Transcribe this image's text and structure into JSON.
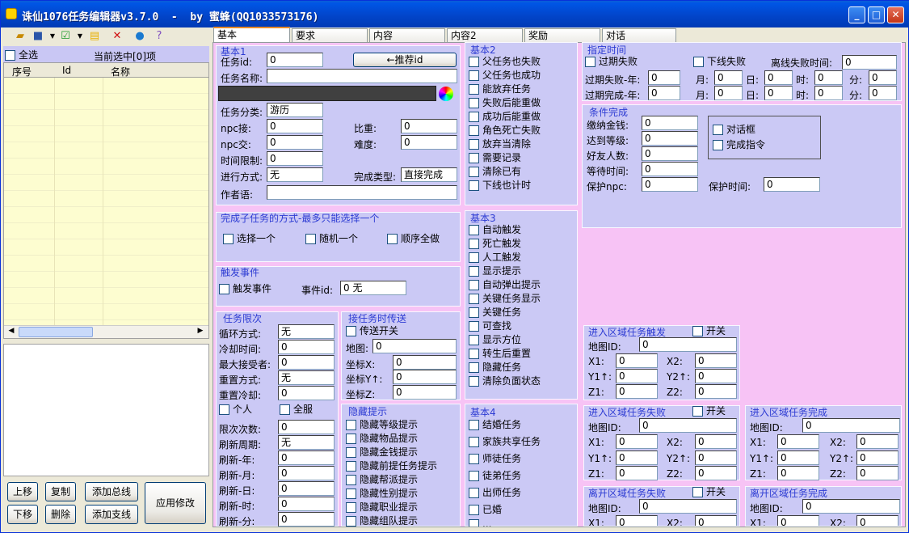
{
  "window": {
    "title": "诛仙1076任务编辑器v3.7.0  -  by 蜜蜂(QQ1033573176)",
    "min": "_",
    "max": "□",
    "close": "✕"
  },
  "toolbar": {
    "icons": [
      "open-folder-icon",
      "save-icon",
      "dropdown-arrow-icon",
      "check-green-icon",
      "dropdown-arrow-icon",
      "folder-icon",
      "delete-x-icon",
      "check-blue-icon",
      "help-icon"
    ]
  },
  "left": {
    "select_all": "全选",
    "selected": "当前选中[0]项",
    "columns": [
      "序号",
      "Id",
      "名称"
    ],
    "buttons": {
      "up": "上移",
      "copy": "复制",
      "add_main": "添加总线",
      "apply": "应用修改",
      "down": "下移",
      "delete": "删除",
      "add_branch": "添加支线"
    }
  },
  "tabs": [
    "基本",
    "要求",
    "内容",
    "内容2",
    "奖励",
    "对话"
  ],
  "basic1": {
    "title": "基本1",
    "id_label": "任务id:",
    "id": "0",
    "recommend": "←推荐id",
    "name_label": "任务名称:",
    "name": "",
    "category_label": "任务分类:",
    "category": "游历",
    "npc_recv_label": "npc接:",
    "npc_recv": "0",
    "weight_label": "比重:",
    "weight": "0",
    "npc_turn_label": "npc交:",
    "npc_turn": "0",
    "difficulty_label": "难度:",
    "difficulty": "0",
    "time_limit_label": "时间限制:",
    "time_limit": "0",
    "mode_label": "进行方式:",
    "mode": "无",
    "complete_type_label": "完成类型:",
    "complete_type": "直接完成",
    "author_label": "作者语:",
    "author": ""
  },
  "subtask": {
    "title": "完成子任务的方式-最多只能选择一个",
    "opts": [
      "选择一个",
      "随机一个",
      "顺序全做"
    ]
  },
  "trigger": {
    "title": "触发事件",
    "cb": "触发事件",
    "event_label": "事件id:",
    "event": "0  无"
  },
  "limit": {
    "title": "任务限次",
    "loop_label": "循环方式:",
    "loop": "无",
    "cooldown_label": "冷却时间:",
    "cooldown": "0",
    "max_label": "最大接受者:",
    "max": "0",
    "reset_label": "重置方式:",
    "reset": "无",
    "reset_cd_label": "重置冷却:",
    "reset_cd": "0",
    "personal": "个人",
    "server": "全服",
    "count_label": "限次次数:",
    "count": "0",
    "period_label": "刷新周期:",
    "period": "无",
    "y_label": "刷新-年:",
    "y": "0",
    "m_label": "刷新-月:",
    "m": "0",
    "d_label": "刷新-日:",
    "d": "0",
    "h_label": "刷新-时:",
    "h": "0",
    "min_label": "刷新-分:",
    "min": "0"
  },
  "teleport": {
    "title": "接任务时传送",
    "cb": "传送开关",
    "map_label": "地图:",
    "map": "0",
    "x_label": "坐标X:",
    "x": "0",
    "y_label": "坐标Y↑:",
    "y": "0",
    "z_label": "坐标Z:",
    "z": "0"
  },
  "hidden": {
    "title": "隐藏提示",
    "items": [
      "隐藏等级提示",
      "隐藏物品提示",
      "隐藏金钱提示",
      "隐藏前提任务提示",
      "隐藏帮派提示",
      "隐藏性别提示",
      "隐藏职业提示",
      "隐藏组队提示"
    ]
  },
  "basic2": {
    "title": "基本2",
    "items": [
      "父任务也失败",
      "父任务也成功",
      "能放弃任务",
      "失败后能重做",
      "成功后能重做",
      "角色死亡失败",
      "放弃当清除",
      "需要记录",
      "清除已有",
      "下线也计时"
    ]
  },
  "basic3": {
    "title": "基本3",
    "items": [
      "自动触发",
      "死亡触发",
      "人工触发",
      "显示提示",
      "自动弹出提示",
      "关键任务显示",
      "关键任务",
      "可查找",
      "显示方位",
      "转生后重置",
      "隐藏任务",
      "清除负面状态"
    ]
  },
  "basic4": {
    "title": "基本4",
    "items": [
      "结婚任务",
      "家族共享任务",
      "师徒任务",
      "徒弟任务",
      "出师任务",
      "已婚",
      "..."
    ]
  },
  "timing": {
    "title": "指定时间",
    "expire_fail": "过期失败",
    "offline_fail": "下线失败",
    "offline_time_label": "离线失败时间:",
    "offline_time": "0",
    "ef_label": "过期失败-年:",
    "ec_label": "过期完成-年:",
    "month": "月:",
    "day": "日:",
    "hour": "时:",
    "minute": "分:",
    "zero": "0"
  },
  "cond": {
    "title": "条件完成",
    "money_label": "缴纳金钱:",
    "money": "0",
    "level_label": "达到等级:",
    "level": "0",
    "friends_label": "好友人数:",
    "friends": "0",
    "wait_label": "等待时间:",
    "wait": "0",
    "npc_label": "保护npc:",
    "npc": "0",
    "protect_label": "保护时间:",
    "protect": "0",
    "dialog": "对话框",
    "finish_cmd": "完成指令"
  },
  "areas": {
    "toggle": "开关",
    "map_label": "地图ID:",
    "x1": "X1:",
    "x2": "X2:",
    "y1": "Y1↑:",
    "y2": "Y2↑:",
    "z1": "Z1:",
    "z2": "Z2:",
    "zero": "0",
    "enter_trigger": "进入区域任务触发",
    "enter_fail": "进入区域任务失败",
    "enter_done": "进入区域任务完成",
    "leave_fail": "离开区域任务失败",
    "leave_done": "离开区域任务完成"
  },
  "colors": {
    "panel": "#c9c7f4",
    "pink": "#f7c3f5",
    "title": "#2d3bd3",
    "list": "#fdfdd0"
  }
}
